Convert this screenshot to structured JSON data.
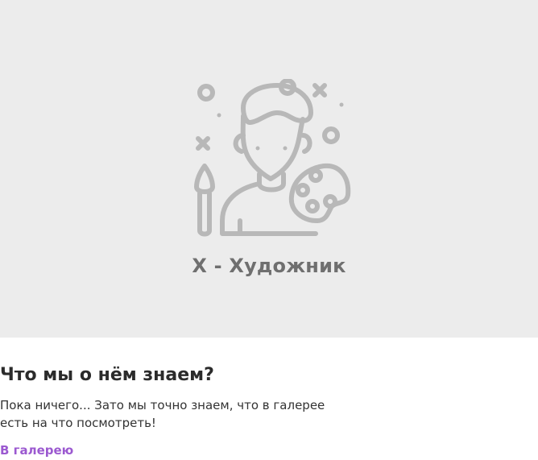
{
  "hero": {
    "title": "X - Художник",
    "illustration_icon": "artist-with-palette-icon",
    "background_color": "#ececec",
    "icon_color": "#b8b8b8"
  },
  "about": {
    "heading": "Что мы о нём знаем?",
    "text": "Пока ничего... Зато мы точно знаем, что в галерее есть на что посмотреть!",
    "link_label": "В галерею",
    "link_color": "#9b59d0"
  }
}
